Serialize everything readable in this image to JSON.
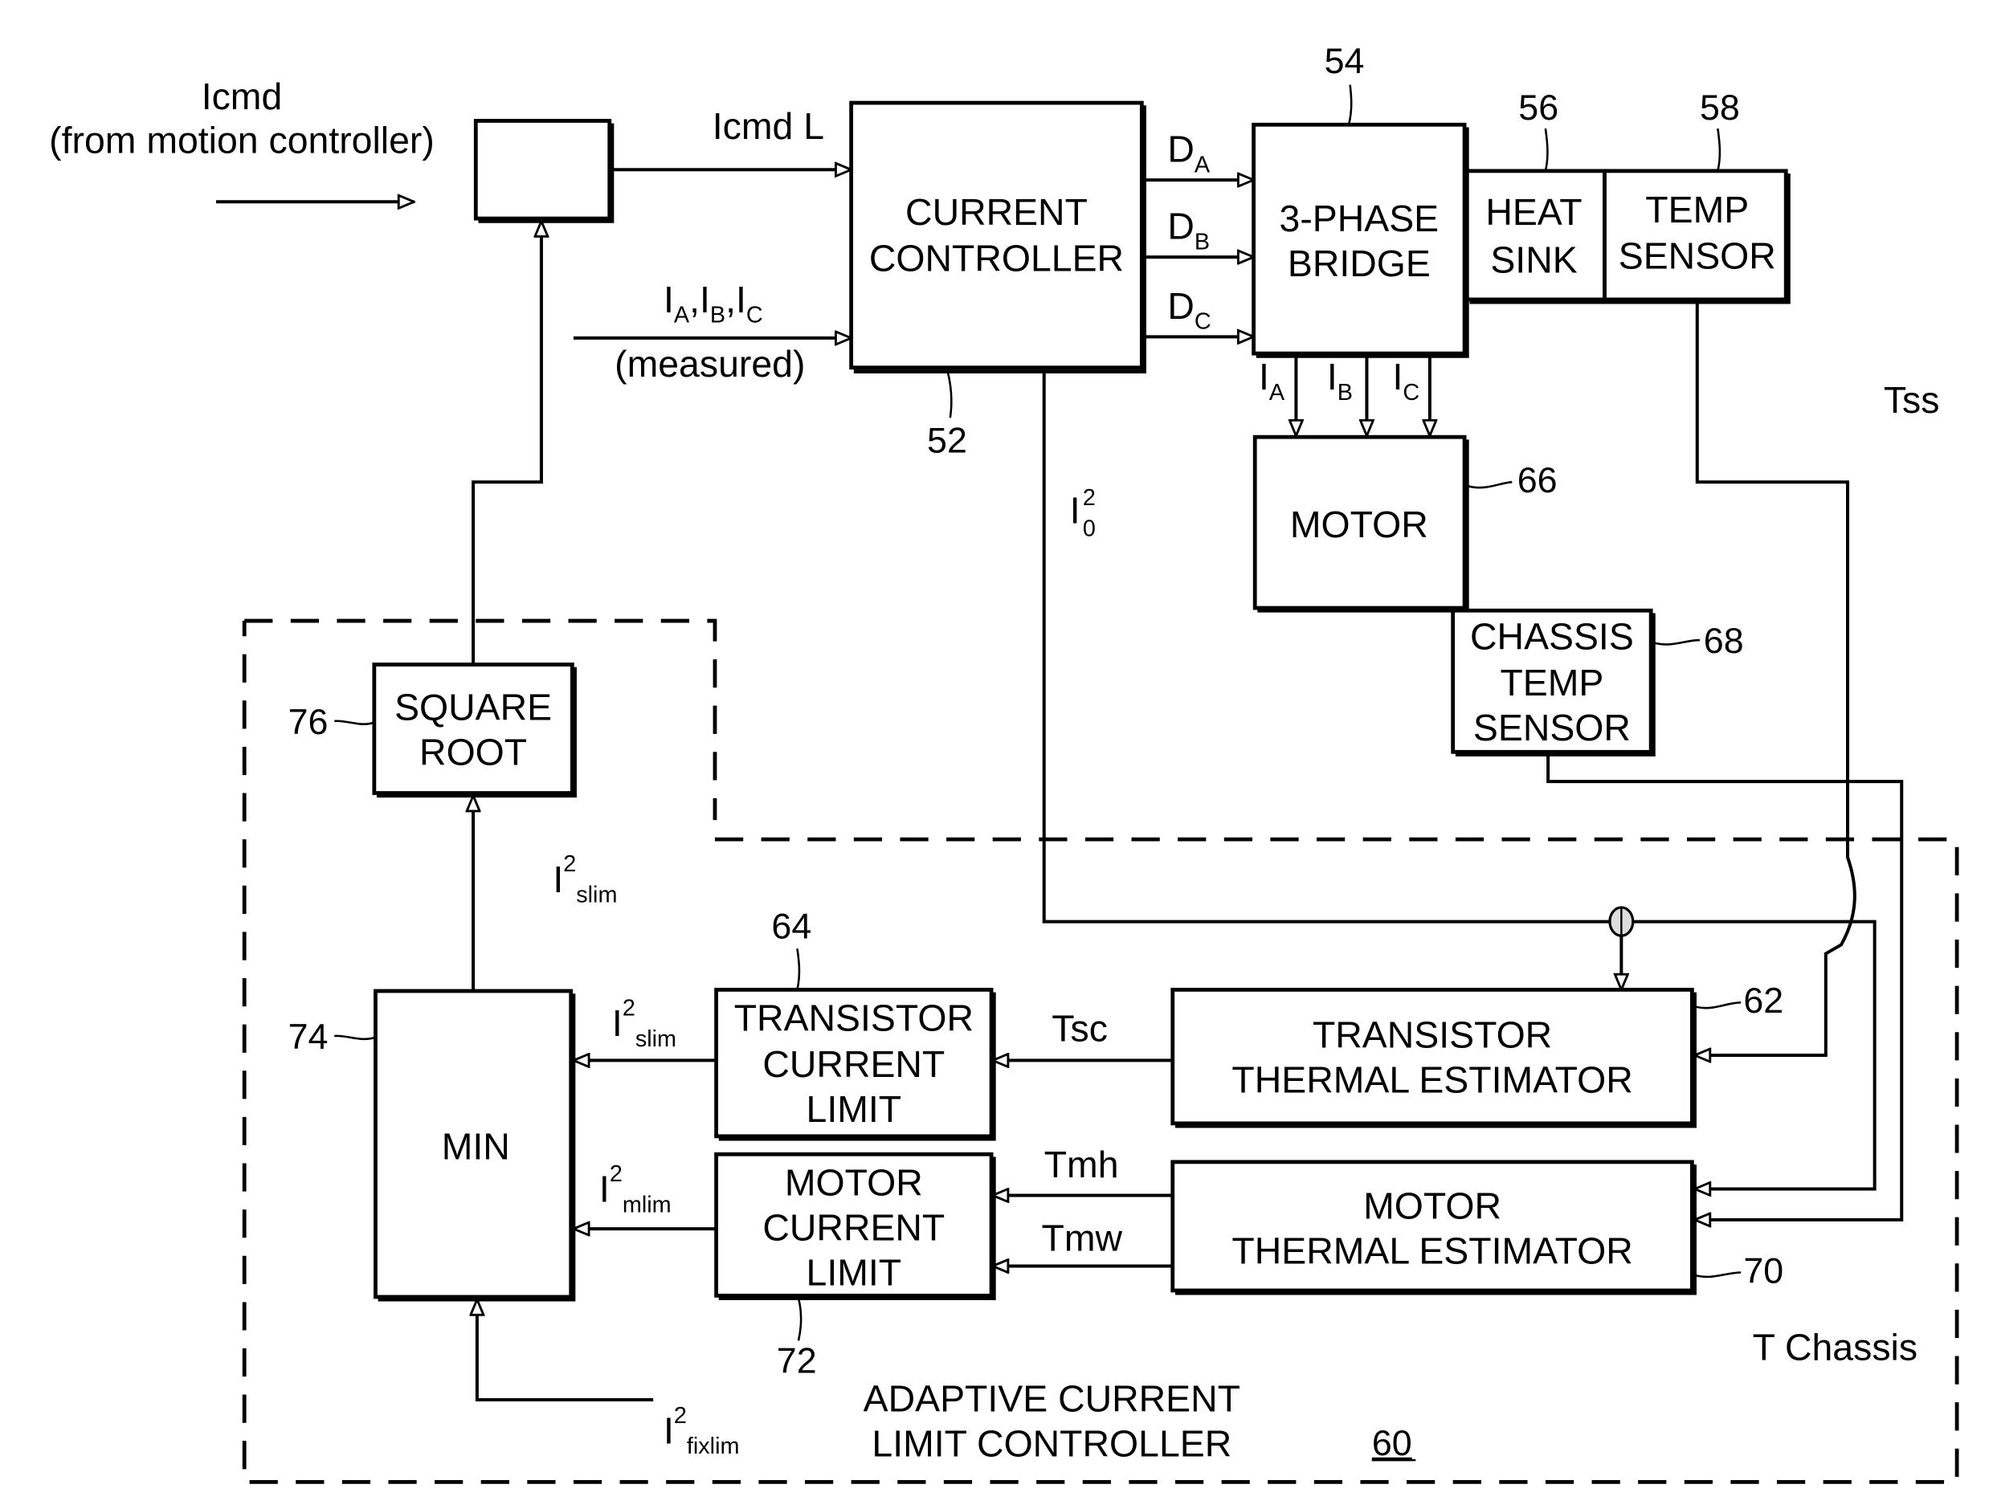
{
  "figure": {
    "inputs": {
      "icmd": "Icmd",
      "icmd_source": "(from motion controller)",
      "icmd_l": "Icmd L",
      "measured_currents": {
        "base": "I",
        "subs": [
          "A",
          "B",
          "C"
        ],
        "note": "(measured)"
      }
    },
    "blocks": {
      "limiter": {
        "label": ""
      },
      "current_controller": {
        "lines": [
          "CURRENT",
          "CONTROLLER"
        ],
        "ref": "52"
      },
      "bridge": {
        "lines": [
          "3-PHASE",
          "BRIDGE"
        ],
        "ref": "54"
      },
      "heat_sink": {
        "lines": [
          "HEAT",
          "SINK"
        ],
        "ref": "56"
      },
      "temp_sensor": {
        "lines": [
          "TEMP",
          "SENSOR"
        ],
        "ref": "58"
      },
      "motor": {
        "lines": [
          "MOTOR"
        ],
        "ref": "66"
      },
      "chassis_temp_sensor": {
        "lines": [
          "CHASSIS",
          "TEMP",
          "SENSOR"
        ],
        "ref": "68"
      },
      "square_root": {
        "lines": [
          "SQUARE",
          "ROOT"
        ],
        "ref": "76"
      },
      "min": {
        "lines": [
          "MIN"
        ],
        "ref": "74"
      },
      "transistor_current_limit": {
        "lines": [
          "TRANSISTOR",
          "CURRENT",
          "LIMIT"
        ],
        "ref": "64"
      },
      "motor_current_limit": {
        "lines": [
          "MOTOR",
          "CURRENT",
          "LIMIT"
        ],
        "ref": "72"
      },
      "transistor_thermal_estimator": {
        "lines": [
          "TRANSISTOR",
          "THERMAL ESTIMATOR"
        ],
        "ref": "62"
      },
      "motor_thermal_estimator": {
        "lines": [
          "MOTOR",
          "THERMAL ESTIMATOR"
        ],
        "ref": "70"
      }
    },
    "signals": {
      "da": {
        "base": "D",
        "sub": "A"
      },
      "db": {
        "base": "D",
        "sub": "B"
      },
      "dc": {
        "base": "D",
        "sub": "C"
      },
      "ia": {
        "base": "I",
        "sub": "A"
      },
      "ib": {
        "base": "I",
        "sub": "B"
      },
      "ic": {
        "base": "I",
        "sub": "C"
      },
      "i0_sq": {
        "base": "I",
        "sub": "0",
        "sup": "2"
      },
      "tss": "Tss",
      "tsc": "Tsc",
      "tmh": "Tmh",
      "tmw": "Tmw",
      "t_chassis": "T Chassis",
      "i_slim_sq_out": {
        "base": "I",
        "sub": "slim",
        "sup": "2"
      },
      "i_slim_sq_in": {
        "base": "I",
        "sub": "slim",
        "sup": "2"
      },
      "i_mlim_sq": {
        "base": "I",
        "sub": "mlim",
        "sup": "2"
      },
      "i_fixlim_sq": {
        "base": "I",
        "sub": "fixlim",
        "sup": "2"
      }
    },
    "controller_group": {
      "lines": [
        "ADAPTIVE CURRENT",
        "LIMIT CONTROLLER"
      ],
      "ref": "60"
    }
  }
}
